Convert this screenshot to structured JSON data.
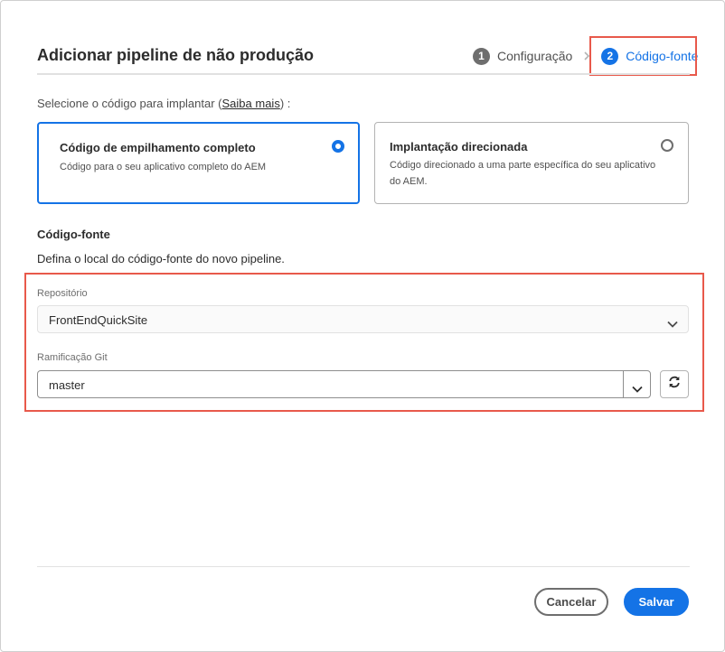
{
  "dialog": {
    "title": "Adicionar pipeline de não produção"
  },
  "steps": [
    {
      "number": "1",
      "label": "Configuração",
      "state": "done"
    },
    {
      "number": "2",
      "label": "Código-fonte",
      "state": "active"
    }
  ],
  "deploy": {
    "prompt_before": "Selecione o código para implantar (",
    "learn_more": "Saiba mais",
    "prompt_after": ") :",
    "options": [
      {
        "title": "Código de empilhamento completo",
        "description": "Código para o seu aplicativo completo do AEM",
        "selected": true
      },
      {
        "title": "Implantação direcionada",
        "description": "Código direcionado a uma parte específica do seu aplicativo do AEM.",
        "selected": false
      }
    ]
  },
  "source": {
    "title": "Código-fonte",
    "description": "Defina o local do código-fonte do novo pipeline.",
    "repository_label": "Repositório",
    "repository_value": "FrontEndQuickSite",
    "branch_label": "Ramificação Git",
    "branch_value": "master"
  },
  "footer": {
    "cancel_label": "Cancelar",
    "save_label": "Salvar"
  },
  "colors": {
    "accent": "#1473e6",
    "highlight": "#e8594b"
  }
}
